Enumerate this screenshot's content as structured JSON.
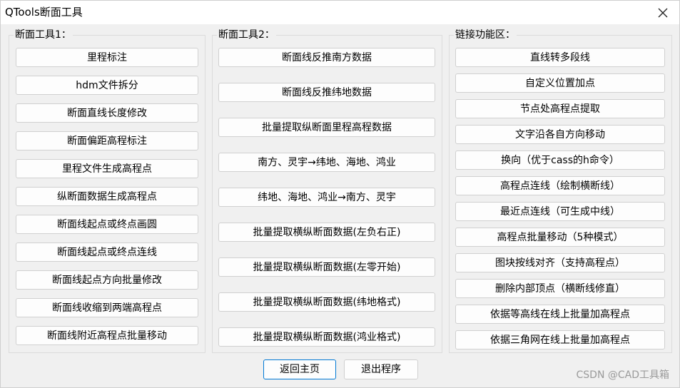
{
  "window": {
    "title": "QTools断面工具"
  },
  "groups": [
    {
      "label": "断面工具1：",
      "buttons": [
        "里程标注",
        "hdm文件拆分",
        "断面直线长度修改",
        "断面偏距高程标注",
        "里程文件生成高程点",
        "纵断面数据生成高程点",
        "断面线起点或终点画圆",
        "断面线起点或终点连线",
        "断面线起点方向批量修改",
        "断面线收缩到两端高程点",
        "断面线附近高程点批量移动"
      ]
    },
    {
      "label": "断面工具2：",
      "buttons": [
        "断面线反推南方数据",
        "断面线反推纬地数据",
        "批量提取纵断面里程高程数据",
        "南方、灵宇→纬地、海地、鸿业",
        "纬地、海地、鸿业→南方、灵宇",
        "批量提取横纵断面数据(左负右正)",
        "批量提取横纵断面数据(左零开始)",
        "批量提取横纵断面数据(纬地格式)",
        "批量提取横纵断面数据(鸿业格式)"
      ]
    },
    {
      "label": "链接功能区：",
      "buttons": [
        "直线转多段线",
        "自定义位置加点",
        "节点处高程点提取",
        "文字沿各自方向移动",
        "换向（优于cass的h命令）",
        "高程点连线（绘制横断线）",
        "最近点连线（可生成中线）",
        "高程点批量移动（5种模式）",
        "图块按线对齐（支持高程点）",
        "删除内部顶点（横断线修直）",
        "依据等高线在线上批量加高程点",
        "依据三角网在线上批量加高程点"
      ]
    }
  ],
  "footer": {
    "back_label": "返回主页",
    "exit_label": "退出程序"
  },
  "watermark": "CSDN @CAD工具箱"
}
